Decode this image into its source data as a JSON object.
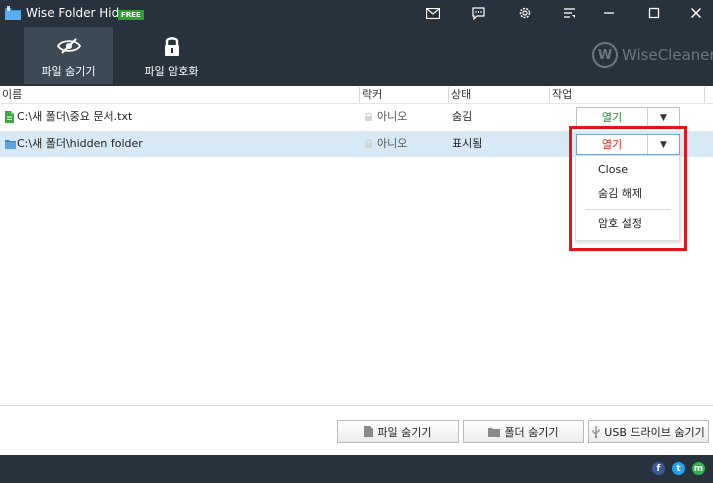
{
  "app": {
    "title": "Wise Folder Hider",
    "badge": "FREE",
    "brand_initial": "W",
    "brand": "WiseCleaner"
  },
  "titlebar_icons": [
    "mail-icon",
    "feedback-icon",
    "settings-icon",
    "menu-icon",
    "minimize-icon",
    "maximize-icon",
    "close-icon"
  ],
  "tabs": [
    {
      "label": "파일 숨기기",
      "icon": "eye-slash-icon",
      "active": true
    },
    {
      "label": "파일 암호화",
      "icon": "lock-icon",
      "active": false
    }
  ],
  "columns": {
    "name": "이름",
    "locker": "락커",
    "status": "상태",
    "action": "작업"
  },
  "rows": [
    {
      "icon": "file-icon",
      "name": "C:\\새 폴더\\중요 문서.txt",
      "locker": "아니오",
      "status": "숨김",
      "action": "열기",
      "action_color": "#1e8c2e",
      "dropdown": "▼"
    },
    {
      "icon": "folder-icon",
      "name": "C:\\새 폴더\\hidden folder",
      "locker": "아니오",
      "status": "표시됨",
      "action": "열기",
      "action_color": "#d9251c",
      "dropdown": "▼"
    }
  ],
  "menu": {
    "items": [
      "Close",
      "숨김 해제",
      "암호 설정"
    ]
  },
  "bottom": {
    "hide_file": "파일 숨기기",
    "hide_folder": "폴더 숨기기",
    "hide_usb": "USB 드라이브 숨기기"
  },
  "footer": {
    "facebook": "f",
    "twitter": "t",
    "message": "m"
  },
  "colors": {
    "header_bg": "#27323c",
    "active_tab_bg": "#3c4a56",
    "selected_row_bg": "#d6e9f4",
    "highlight_border": "#e4141b"
  }
}
